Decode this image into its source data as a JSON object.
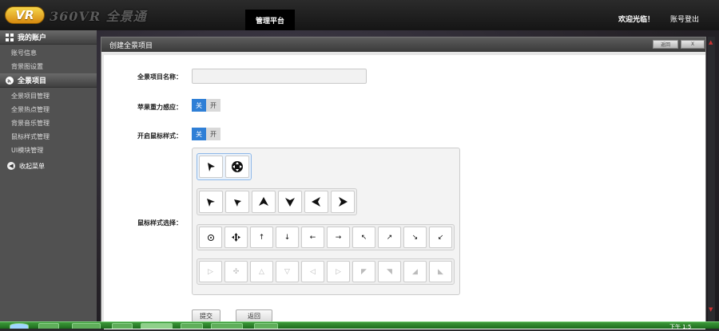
{
  "header": {
    "logo_badge": "VR",
    "logo_text": "360VR 全景通",
    "platform_tab": "管理平台",
    "welcome": "欢迎光临！",
    "logout": "账号登出"
  },
  "sidebar": {
    "section_account": "我的账户",
    "account_items": [
      "账号信息",
      "背景图设置"
    ],
    "section_projects": "全景项目",
    "project_items": [
      "全景项目管理",
      "全景热点管理",
      "背景音乐管理",
      "鼠标样式管理",
      "UI模块管理"
    ],
    "collapse": "收起菜单"
  },
  "panel": {
    "title": "创建全景项目",
    "back": "返回",
    "close": "X"
  },
  "form": {
    "name_label": "全景项目名称：",
    "name_value": "",
    "gyro_label": "苹果重力感应：",
    "cursor_enable_label": "开启鼠标样式：",
    "toggle_off": "关",
    "toggle_on": "开",
    "cursor_select_label": "鼠标样式选择：",
    "submit": "提交",
    "return": "返回"
  },
  "cursor_rows": [
    [
      "arrow-cursor-icon",
      "move-cursor-icon"
    ],
    [
      "arrow-left-icon",
      "arrow-right-icon",
      "arrow-up-icon",
      "arrow-down-icon",
      "arrow-left-thick-icon",
      "arrow-right-thick-icon"
    ],
    [
      "target-icon",
      "move-icon",
      "up-small-icon",
      "down-small-icon",
      "left-small-icon",
      "right-small-icon",
      "nw-icon",
      "ne-icon",
      "se-icon",
      "sw-icon"
    ],
    [
      "faint-1-icon",
      "faint-2-icon",
      "faint-3-icon",
      "faint-4-icon",
      "faint-5-icon",
      "faint-6-icon",
      "faint-7-icon",
      "faint-8-icon",
      "faint-9-icon",
      "faint-10-icon"
    ]
  ],
  "taskbar": {
    "clock": "下午 1:5"
  },
  "colors": {
    "accent": "#2f7fd6",
    "taskbar": "#2b8a2b"
  }
}
